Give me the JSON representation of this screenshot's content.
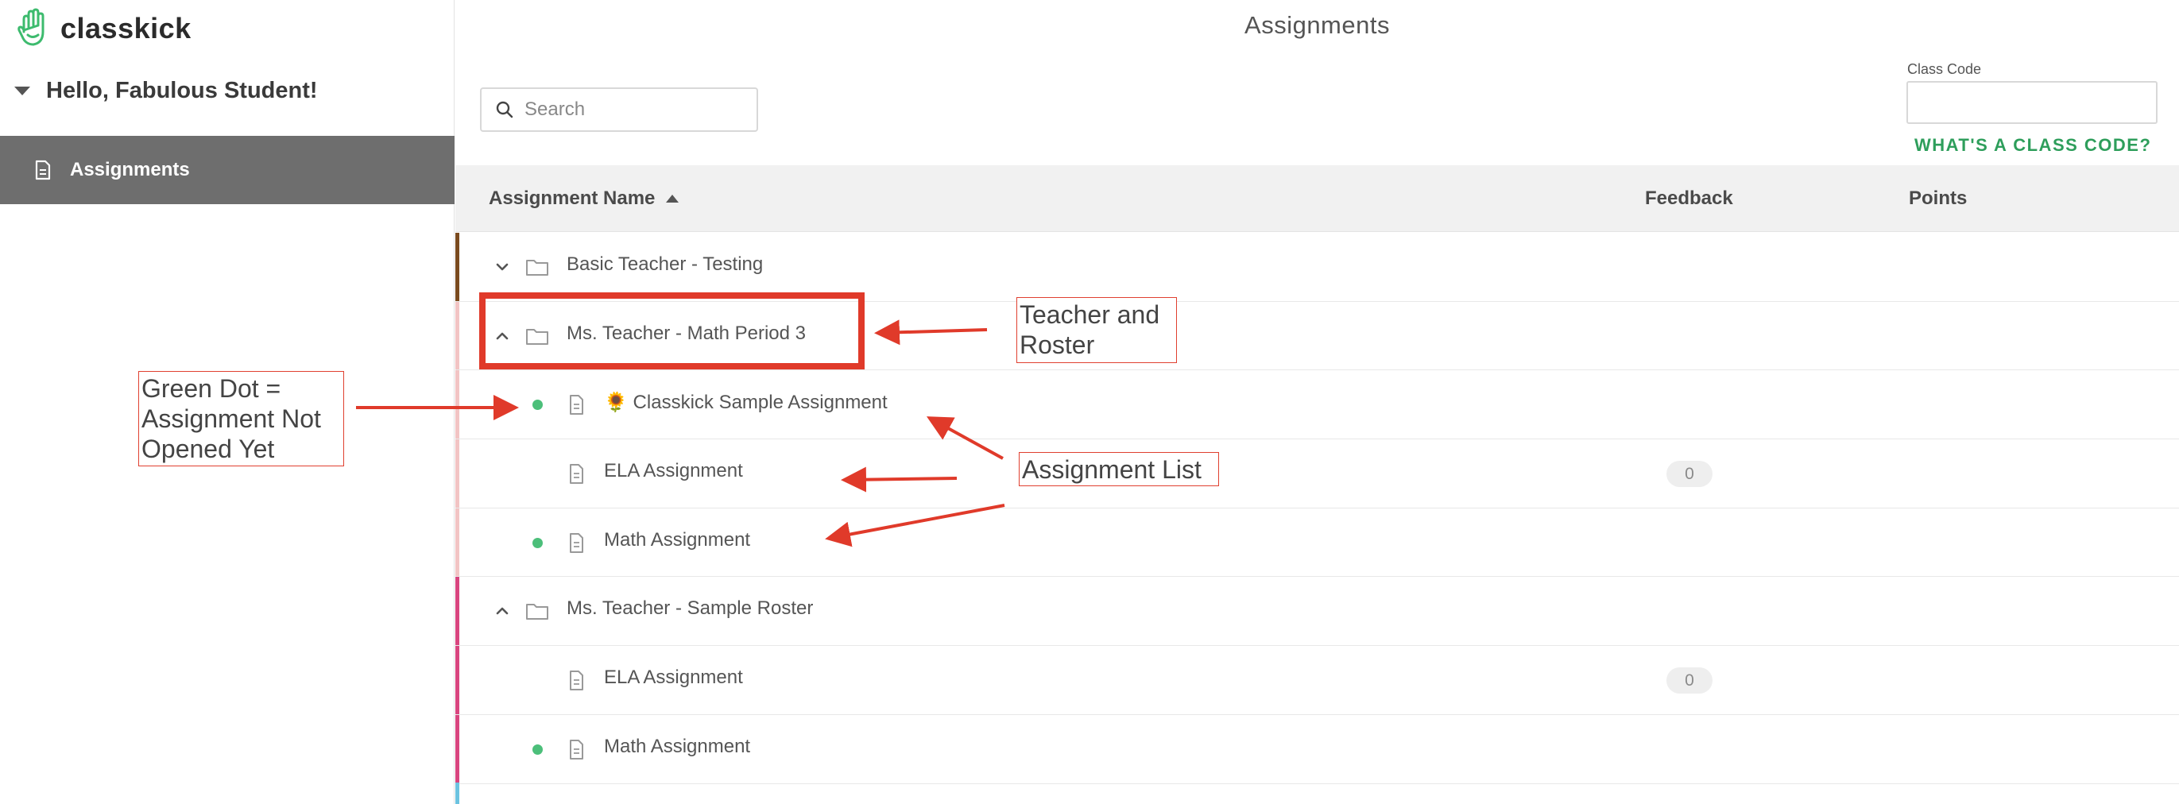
{
  "app": {
    "logo_text": "classkick",
    "logo_icon": "hand-icon"
  },
  "sidebar": {
    "greeting": "Hello, Fabulous Student!",
    "items": [
      {
        "label": "Assignments",
        "icon": "document-icon",
        "active": true
      }
    ]
  },
  "header": {
    "title": "Assignments",
    "search_placeholder": "Search",
    "class_code_label": "Class Code",
    "class_code_value": "",
    "class_code_help": "WHAT'S A CLASS CODE?"
  },
  "table": {
    "columns": {
      "name": "Assignment Name",
      "feedback": "Feedback",
      "points": "Points"
    },
    "rows": [
      {
        "type": "folder",
        "label": "Basic Teacher - Testing",
        "expanded": false,
        "color": "#7a4a1e"
      },
      {
        "type": "folder",
        "label": "Ms. Teacher - Math Period 3",
        "expanded": true,
        "color": "#f2c4c4"
      },
      {
        "type": "item",
        "label": "🌻 Classkick Sample Assignment",
        "new": true,
        "feedback": null,
        "color": "#f2c4c4"
      },
      {
        "type": "item",
        "label": "ELA Assignment",
        "new": false,
        "feedback": "0",
        "color": "#f2c4c4"
      },
      {
        "type": "item",
        "label": "Math Assignment",
        "new": true,
        "feedback": null,
        "color": "#f2c4c4"
      },
      {
        "type": "folder",
        "label": "Ms. Teacher - Sample Roster",
        "expanded": true,
        "color": "#d9457f"
      },
      {
        "type": "item",
        "label": "ELA Assignment",
        "new": false,
        "feedback": "0",
        "color": "#d9457f"
      },
      {
        "type": "item",
        "label": "Math Assignment",
        "new": true,
        "feedback": null,
        "color": "#d9457f"
      }
    ]
  },
  "annotations": {
    "teacher_roster": "Teacher and Roster",
    "assignment_list": "Assignment List",
    "green_dot": "Green Dot = Assignment Not Opened Yet"
  },
  "colors": {
    "accent_green": "#2e9e5b",
    "new_dot": "#4cbf7a",
    "annotation_red": "#e03a2a"
  }
}
